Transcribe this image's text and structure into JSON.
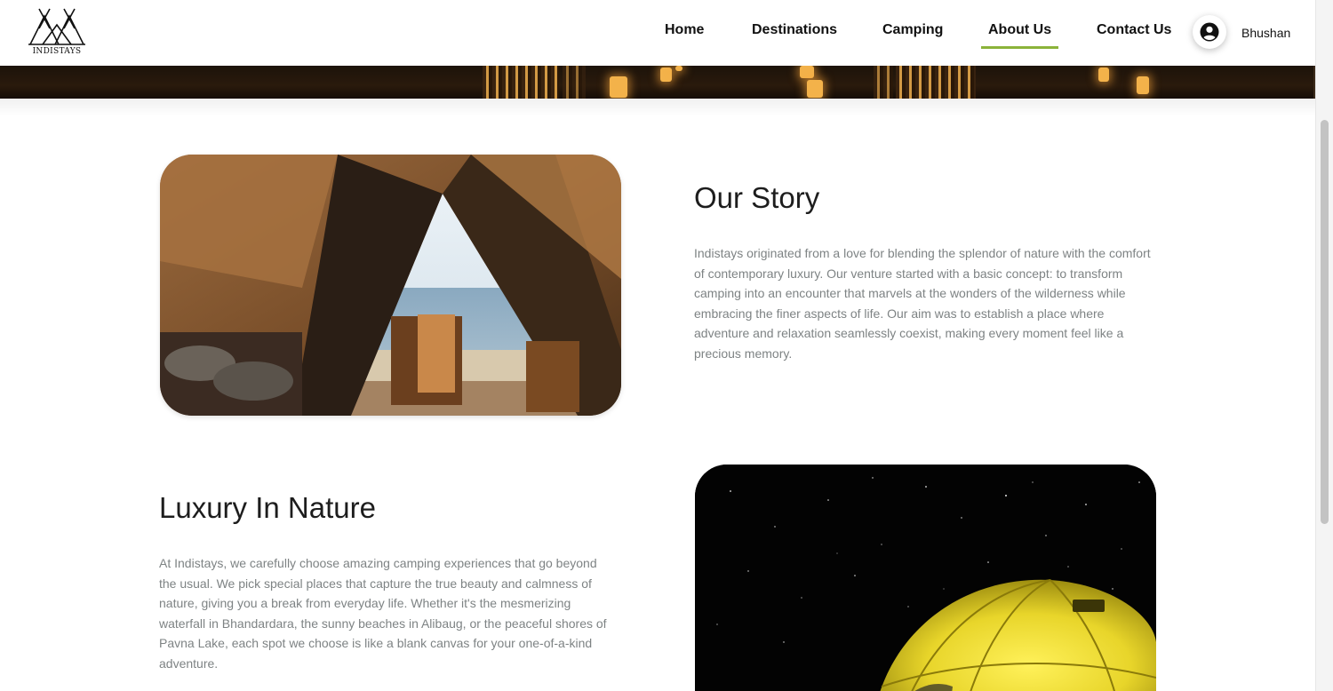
{
  "header": {
    "logo_text": "INDISTAYS",
    "nav": [
      {
        "label": "Home"
      },
      {
        "label": "Destinations"
      },
      {
        "label": "Camping"
      },
      {
        "label": "About Us",
        "active": true
      },
      {
        "label": "Contact Us"
      }
    ],
    "user": {
      "name": "Bhushan",
      "icon": "user-circle-icon"
    },
    "accent_color": "#8bb33a"
  },
  "sections": [
    {
      "title": "Our Story",
      "body": "Indistays originated from a love for blending the splendor of nature with the comfort of contemporary luxury. Our venture started with a basic concept: to transform camping into an encounter that marvels at the wonders of the wilderness while embracing the finer aspects of life. Our aim was to establish a place where adventure and relaxation seamlessly coexist, making every moment feel like a precious memory."
    },
    {
      "title": "Luxury In Nature",
      "body": "At Indistays, we carefully choose amazing camping experiences that go beyond the usual. We pick special places that capture the true beauty and calmness of nature, giving you a break from everyday life. Whether it's the mesmerizing waterfall in Bhandardara, the sunny beaches in Alibaug, or the peaceful shores of Pavna Lake, each spot we choose is like a blank canvas for your one-of-a-kind adventure."
    }
  ]
}
